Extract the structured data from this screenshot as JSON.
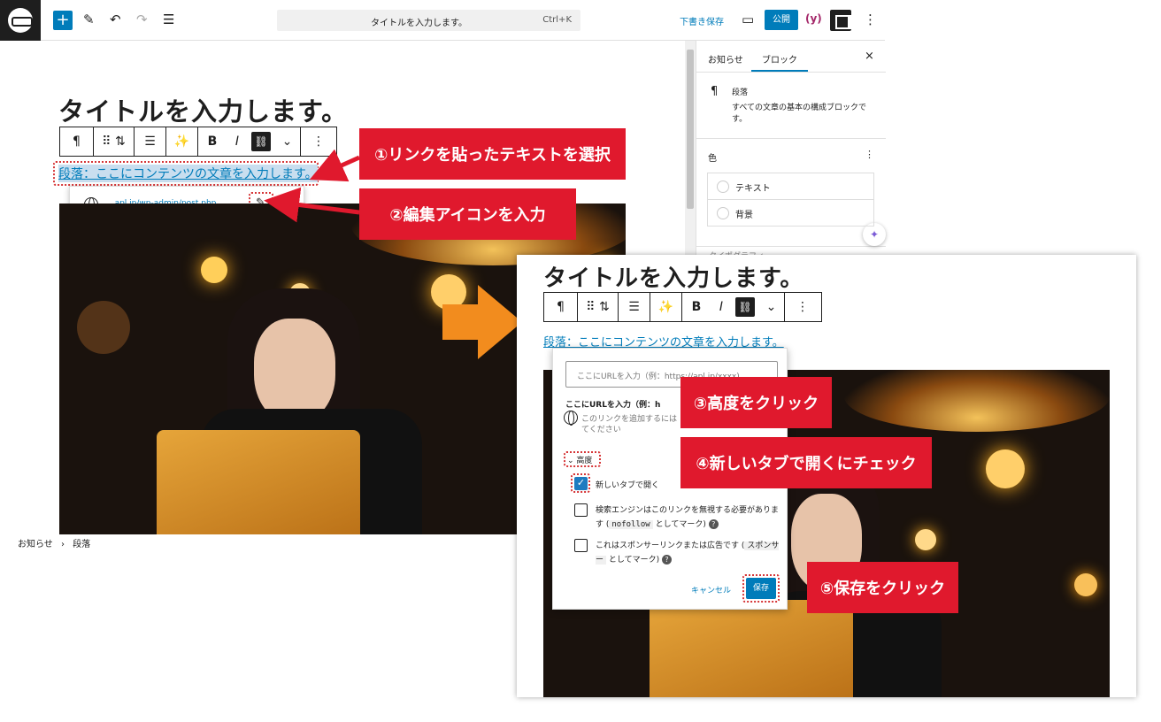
{
  "topbar": {
    "icons": [
      "wp-logo",
      "add",
      "pen",
      "undo",
      "redo",
      "list-view"
    ],
    "command": "タイトルを入力します。",
    "shortcut": "Ctrl+K",
    "draft": "下書き保存",
    "publish": "公開",
    "yoast": "(y)"
  },
  "editor": {
    "title": "タイトルを入力します。",
    "paragraph": "段落：ここにコンテンツの文章を入力します。",
    "link_url": "...apl.jp/wp-admin/post.php",
    "toolbar": [
      "¶",
      "⠿",
      "⌃⌄",
      "⊟",
      "✨",
      "B",
      "I",
      "⛓",
      "⌄",
      "⋮"
    ]
  },
  "sidebar": {
    "tab_post": "お知らせ",
    "tab_block": "ブロック",
    "block_name": "段落",
    "block_desc": "すべての文章の基本の構成ブロックです。",
    "color_label": "色",
    "color_text": "テキスト",
    "color_bg": "背景",
    "typography": "タイポグラフィ"
  },
  "breadcrumb": {
    "root": "お知らせ",
    "sep": "›",
    "current": "段落"
  },
  "callouts": {
    "c1": "①リンクを貼ったテキストを選択",
    "c2": "②編集アイコンを入力",
    "c3": "③高度をクリック",
    "c4": "④新しいタブで開くにチェック",
    "c5": "⑤保存をクリック"
  },
  "inset": {
    "title": "タイトルを入力します。",
    "paragraph": "段落：ここにコンテンツの文章を入力します。",
    "url_placeholder": "ここにURLを入力（例：https://apl.jp/xxxx)",
    "suggest_title": "ここにURLを入力（例：h",
    "suggest_desc": "このリンクを追加するには",
    "suggest_desc2": "てください",
    "advanced": "高度",
    "new_tab": "新しいタブで開く",
    "nofollow_pre": "検索エンジンはこのリンクを無視する必要があります (",
    "nofollow_code": "nofollow",
    "nofollow_post": "としてマーク)",
    "sponsor_pre": "これはスポンサーリンクまたは広告です (",
    "sponsor_code": "スポンサー",
    "sponsor_post": "としてマーク)",
    "cancel": "キャンセル",
    "save": "保存"
  },
  "colors": {
    "accent": "#007cba",
    "callout": "#e0192d",
    "arrow": "#f28c1e"
  }
}
